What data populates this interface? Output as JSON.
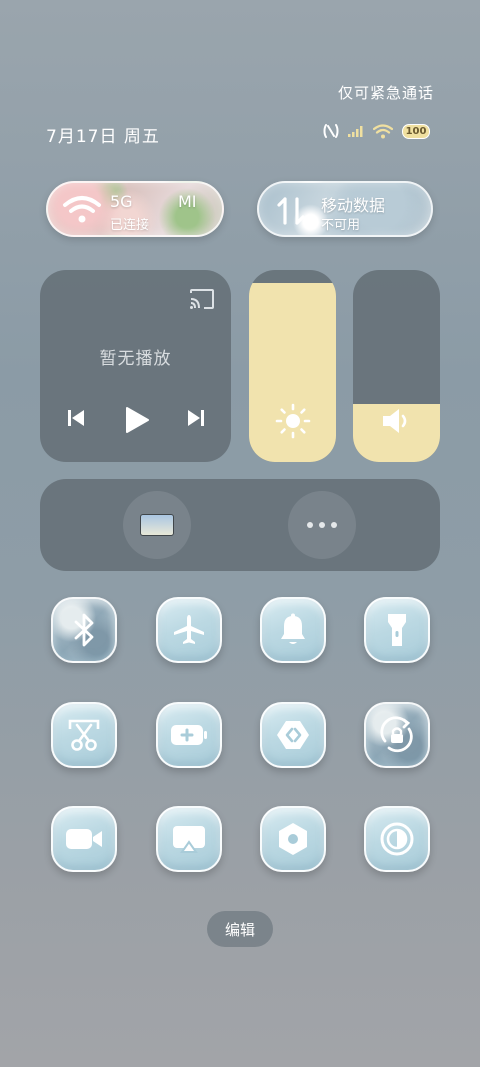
{
  "status": {
    "emergency_text": "仅可紧急通话",
    "date_text": "7月17日 周五",
    "battery_level": "100"
  },
  "connectivity": {
    "wifi": {
      "name": "5G",
      "name_extra": "MI",
      "state": "已连接"
    },
    "mobile_data": {
      "label": "移动数据",
      "state": "不可用"
    }
  },
  "media": {
    "no_playback": "暂无播放"
  },
  "sliders": {
    "brightness_level": 0.93,
    "volume_level": 0.3
  },
  "shortcuts": [
    {
      "icon": "bluetooth-icon",
      "active": true
    },
    {
      "icon": "airplane-icon",
      "active": false
    },
    {
      "icon": "bell-icon",
      "active": false
    },
    {
      "icon": "flashlight-icon",
      "active": false
    },
    {
      "icon": "screenshot-scissors-icon",
      "active": false
    },
    {
      "icon": "battery-saver-icon",
      "active": false
    },
    {
      "icon": "nearby-share-icon",
      "active": false
    },
    {
      "icon": "rotation-lock-icon",
      "active": true
    },
    {
      "icon": "video-camera-icon",
      "active": false
    },
    {
      "icon": "screen-cast-icon",
      "active": false
    },
    {
      "icon": "settings-hex-icon",
      "active": false
    },
    {
      "icon": "reading-mode-icon",
      "active": false
    }
  ],
  "edit_label": "编辑",
  "colors": {
    "accent_fill": "#f1e3ae",
    "tile": "#bcd9e3"
  }
}
